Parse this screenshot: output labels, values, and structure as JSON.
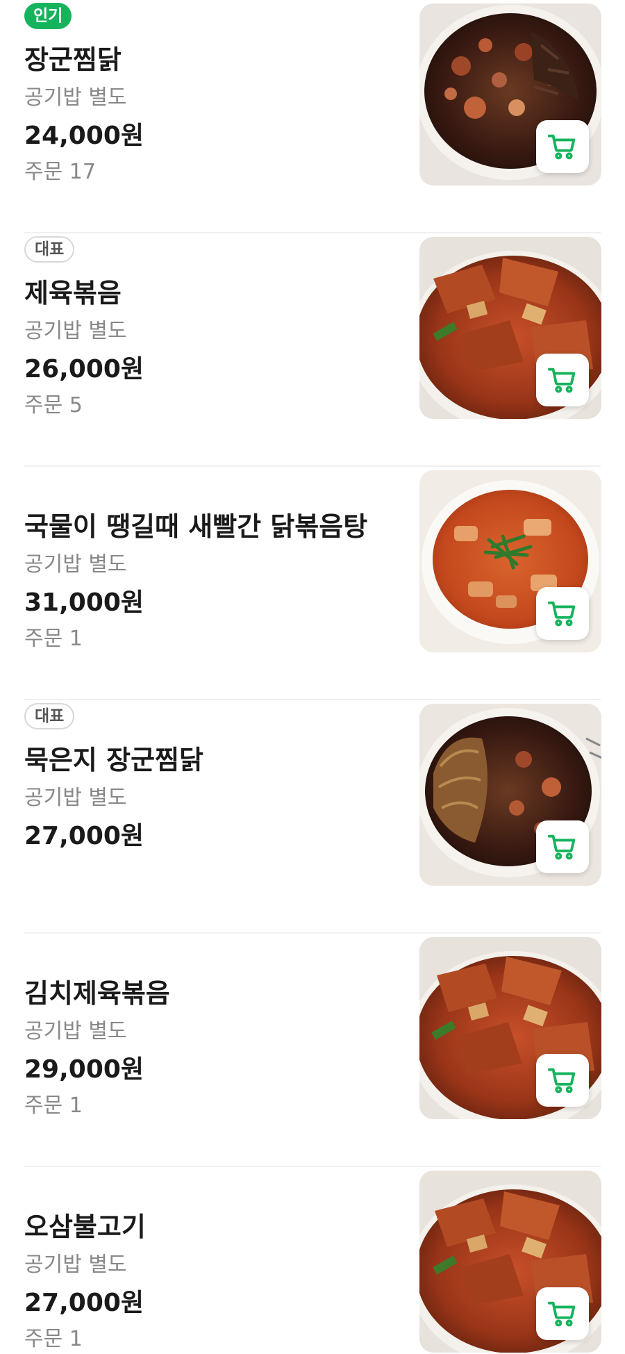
{
  "colors": {
    "accent": "#16b35d",
    "text_primary": "#1a1a1a",
    "text_secondary": "#888888",
    "divider": "#f0f0f0"
  },
  "menu": {
    "items": [
      {
        "badge": "인기",
        "badge_type": "popular",
        "name": "장군찜닭",
        "description": "공기밥 별도",
        "price": "24,000원",
        "orders": "주문 17",
        "photo": "jjimdak-dish",
        "cart_icon": "cart-icon"
      },
      {
        "badge": "대표",
        "badge_type": "signature",
        "name": "제육볶음",
        "description": "공기밥 별도",
        "price": "26,000원",
        "orders": "주문 5",
        "photo": "jeyuk-dish",
        "cart_icon": "cart-icon"
      },
      {
        "badge": "",
        "badge_type": "none",
        "name": "국물이 땡길때 새빨간 닭볶음탕",
        "description": "공기밥 별도",
        "price": "31,000원",
        "orders": "주문 1",
        "photo": "dakbokkeumtang-dish",
        "cart_icon": "cart-icon"
      },
      {
        "badge": "대표",
        "badge_type": "signature",
        "name": "묵은지 장군찜닭",
        "description": "공기밥 별도",
        "price": "27,000원",
        "orders": "",
        "photo": "kimchi-jjimdak-dish",
        "cart_icon": "cart-icon"
      },
      {
        "badge": "",
        "badge_type": "none",
        "name": "김치제육볶음",
        "description": "공기밥 별도",
        "price": "29,000원",
        "orders": "주문 1",
        "photo": "kimchi-jeyuk-dish",
        "cart_icon": "cart-icon"
      },
      {
        "badge": "",
        "badge_type": "none",
        "name": "오삼불고기",
        "description": "공기밥 별도",
        "price": "27,000원",
        "orders": "주문 1",
        "photo": "osam-bulgogi-dish",
        "cart_icon": "cart-icon"
      }
    ]
  }
}
